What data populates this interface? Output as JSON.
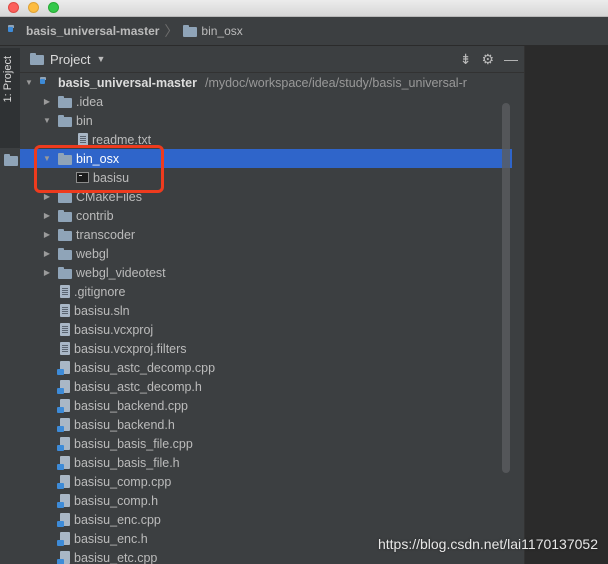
{
  "navbar": {
    "root": "basis_universal-master",
    "child": "bin_osx"
  },
  "leftstrip": {
    "tab_label": "1: Project"
  },
  "panel": {
    "title": "Project",
    "tools": [
      "⇟",
      "⚙",
      "—"
    ]
  },
  "tree": {
    "root": {
      "label": "basis_universal-master",
      "path": "/mydoc/workspace/idea/study/basis_universal-r"
    },
    "rows": [
      {
        "label": ".idea",
        "indent": 1,
        "arrow": "▶",
        "icon": "folder"
      },
      {
        "label": "bin",
        "indent": 1,
        "arrow": "▼",
        "icon": "folder"
      },
      {
        "label": "readme.txt",
        "indent": 2,
        "arrow": "",
        "icon": "file"
      },
      {
        "label": "bin_osx",
        "indent": 1,
        "arrow": "▼",
        "icon": "folder",
        "selected": true
      },
      {
        "label": "basisu",
        "indent": 2,
        "arrow": "",
        "icon": "exec"
      },
      {
        "label": "CMakeFiles",
        "indent": 1,
        "arrow": "▶",
        "icon": "folder"
      },
      {
        "label": "contrib",
        "indent": 1,
        "arrow": "▶",
        "icon": "folder"
      },
      {
        "label": "transcoder",
        "indent": 1,
        "arrow": "▶",
        "icon": "folder"
      },
      {
        "label": "webgl",
        "indent": 1,
        "arrow": "▶",
        "icon": "folder"
      },
      {
        "label": "webgl_videotest",
        "indent": 1,
        "arrow": "▶",
        "icon": "folder"
      },
      {
        "label": ".gitignore",
        "indent": 1,
        "arrow": "",
        "icon": "file"
      },
      {
        "label": "basisu.sln",
        "indent": 1,
        "arrow": "",
        "icon": "file"
      },
      {
        "label": "basisu.vcxproj",
        "indent": 1,
        "arrow": "",
        "icon": "file"
      },
      {
        "label": "basisu.vcxproj.filters",
        "indent": 1,
        "arrow": "",
        "icon": "file"
      },
      {
        "label": "basisu_astc_decomp.cpp",
        "indent": 1,
        "arrow": "",
        "icon": "code"
      },
      {
        "label": "basisu_astc_decomp.h",
        "indent": 1,
        "arrow": "",
        "icon": "code"
      },
      {
        "label": "basisu_backend.cpp",
        "indent": 1,
        "arrow": "",
        "icon": "code"
      },
      {
        "label": "basisu_backend.h",
        "indent": 1,
        "arrow": "",
        "icon": "code"
      },
      {
        "label": "basisu_basis_file.cpp",
        "indent": 1,
        "arrow": "",
        "icon": "code"
      },
      {
        "label": "basisu_basis_file.h",
        "indent": 1,
        "arrow": "",
        "icon": "code"
      },
      {
        "label": "basisu_comp.cpp",
        "indent": 1,
        "arrow": "",
        "icon": "code"
      },
      {
        "label": "basisu_comp.h",
        "indent": 1,
        "arrow": "",
        "icon": "code"
      },
      {
        "label": "basisu_enc.cpp",
        "indent": 1,
        "arrow": "",
        "icon": "code"
      },
      {
        "label": "basisu_enc.h",
        "indent": 1,
        "arrow": "",
        "icon": "code"
      },
      {
        "label": "basisu_etc.cpp",
        "indent": 1,
        "arrow": "",
        "icon": "code"
      }
    ]
  },
  "watermark": "https://blog.csdn.net/lai1170137052",
  "colors": {
    "selection": "#2f65ca",
    "highlight_box": "#ee3b1e",
    "panel_bg": "#3c3f41",
    "editor_bg": "#2b2b2b"
  }
}
